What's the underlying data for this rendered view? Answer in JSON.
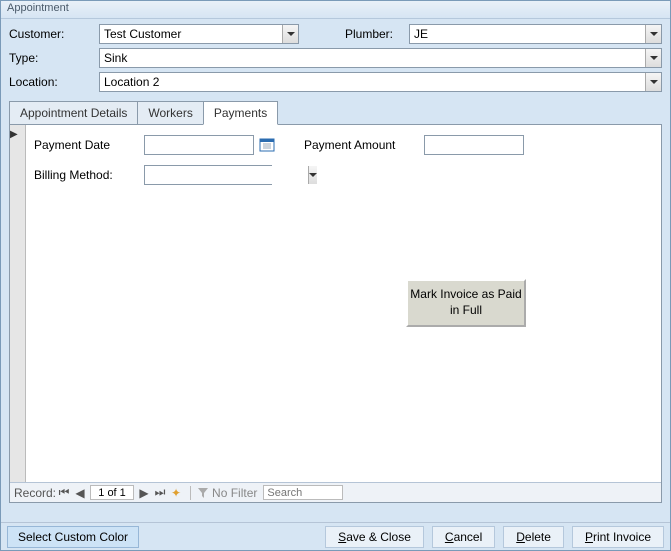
{
  "window": {
    "title": "Appointment"
  },
  "form": {
    "customer_label": "Customer:",
    "customer_value": "Test Customer",
    "plumber_label": "Plumber:",
    "plumber_value": "JE",
    "type_label": "Type:",
    "type_value": "Sink",
    "location_label": "Location:",
    "location_value": "Location 2"
  },
  "tabs": {
    "details": "Appointment Details",
    "workers": "Workers",
    "payments": "Payments"
  },
  "payments": {
    "payment_date_label": "Payment Date",
    "payment_date_value": "",
    "payment_amount_label": "Payment Amount",
    "payment_amount_value": "",
    "billing_method_label": "Billing Method:",
    "billing_method_value": "",
    "mark_paid_button": "Mark Invoice as Paid in Full"
  },
  "recordnav": {
    "record_label": "Record:",
    "position": "1 of 1",
    "no_filter": "No Filter",
    "search_placeholder": "Search"
  },
  "bottombar": {
    "custom_color": "Select Custom Color",
    "save_close": "Save & Close",
    "cancel": "Cancel",
    "delete": "Delete",
    "print_invoice": "Print Invoice"
  }
}
